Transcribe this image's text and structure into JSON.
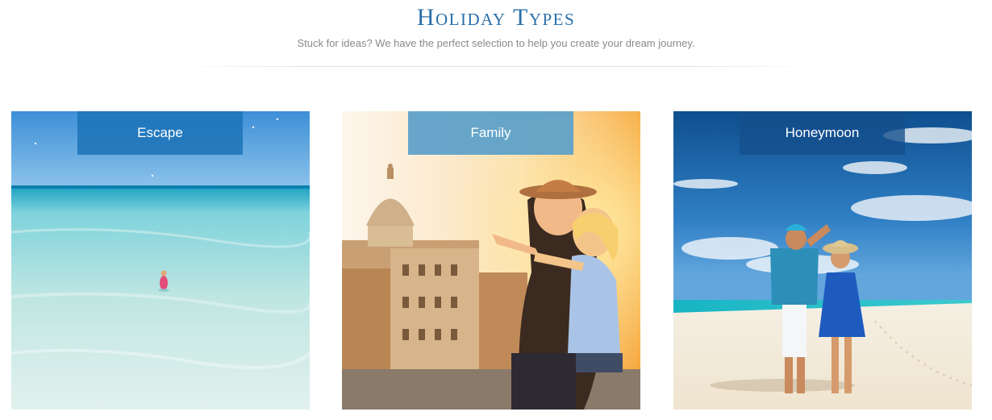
{
  "section": {
    "title": "Holiday Types",
    "subtitle": "Stuck for ideas? We have the perfect selection to help you create your dream journey."
  },
  "cards": [
    {
      "label": "Escape",
      "image": "turquoise-shallow-sea-with-lone-wader"
    },
    {
      "label": "Family",
      "image": "mother-and-child-pointing-over-rome-rooftops"
    },
    {
      "label": "Honeymoon",
      "image": "couple-on-tropical-sandbar"
    }
  ],
  "colors": {
    "title": "#2a6fa8",
    "subtitle": "#8a8a8a",
    "escape_label_bg": "#1e74b8",
    "family_label_bg": "#5ba0c9",
    "honeymoon_label_bg": "#144e8c"
  }
}
